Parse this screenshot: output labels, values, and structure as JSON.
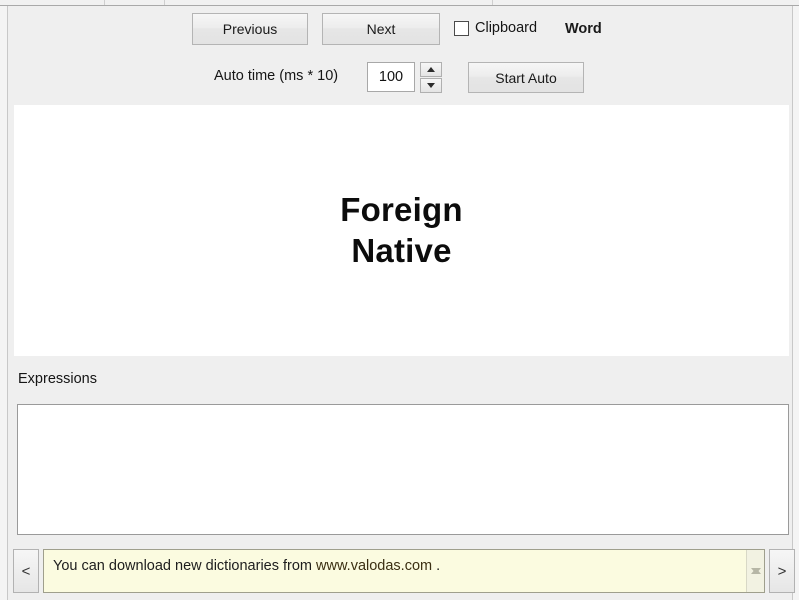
{
  "window": {
    "background_color": "#efefef",
    "panel_color": "#ffffff",
    "status_color": "#fbfbe0",
    "accent_text_color": "#1a1a1a"
  },
  "toolbar": {
    "previous_label": "Previous",
    "next_label": "Next",
    "clipboard_label": "Clipboard",
    "clipboard_checked": false,
    "mode_badge": "Word"
  },
  "auto": {
    "time_label": "Auto time (ms * 10)",
    "time_value": "100",
    "spinner_up_icon": "triangle-up-icon",
    "spinner_down_icon": "triangle-down-icon",
    "start_label": "Start Auto"
  },
  "word_display": {
    "foreign": "Foreign",
    "native": "Native"
  },
  "expressions": {
    "label": "Expressions",
    "value": "",
    "placeholder": ""
  },
  "status_bar": {
    "prev_icon_label": "<",
    "next_icon_label": ">",
    "message_prefix": "You can download new dictionaries from ",
    "message_link": "www.valodas.com",
    "message_suffix": " .",
    "scroll_up_icon": "chevron-up-icon",
    "scroll_down_icon": "chevron-down-icon"
  }
}
